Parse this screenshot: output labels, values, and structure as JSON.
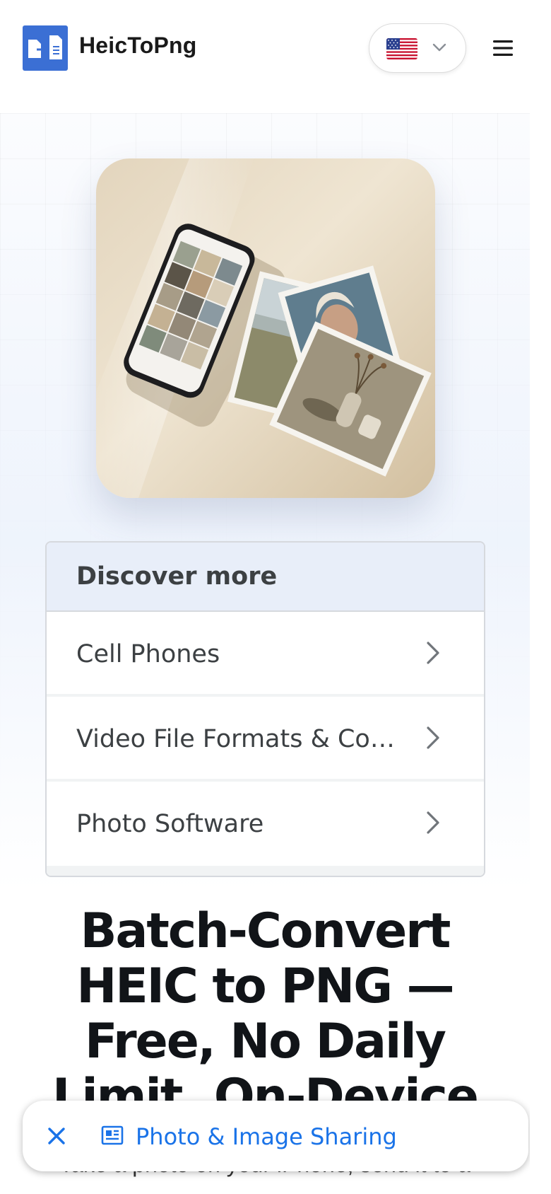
{
  "header": {
    "brand": "HeicToPng",
    "logo_icon": "file-convert-icon",
    "language": {
      "flag": "us-flag-icon",
      "chevron": "chevron-down-icon"
    },
    "menu_icon": "hamburger-menu-icon"
  },
  "hero": {
    "image": "phone-with-printed-photos-illustration"
  },
  "discover": {
    "title": "Discover more",
    "items": [
      {
        "label": "Cell Phones"
      },
      {
        "label": "Video File Formats & Code..."
      },
      {
        "label": "Photo Software"
      }
    ]
  },
  "main": {
    "headline": "Batch-Convert HEIC to PNG — Free, No Daily Limit, On-Device",
    "subtext": "Take a photo on your iPhone, send it to a"
  },
  "anchor_bar": {
    "label": "Photo & Image Sharing",
    "close_icon": "close-icon",
    "article_icon": "article-icon"
  },
  "colors": {
    "brand_blue": "#3b6fd4",
    "link_blue": "#1a73e8",
    "discover_header_bg": "#e8eef9"
  }
}
